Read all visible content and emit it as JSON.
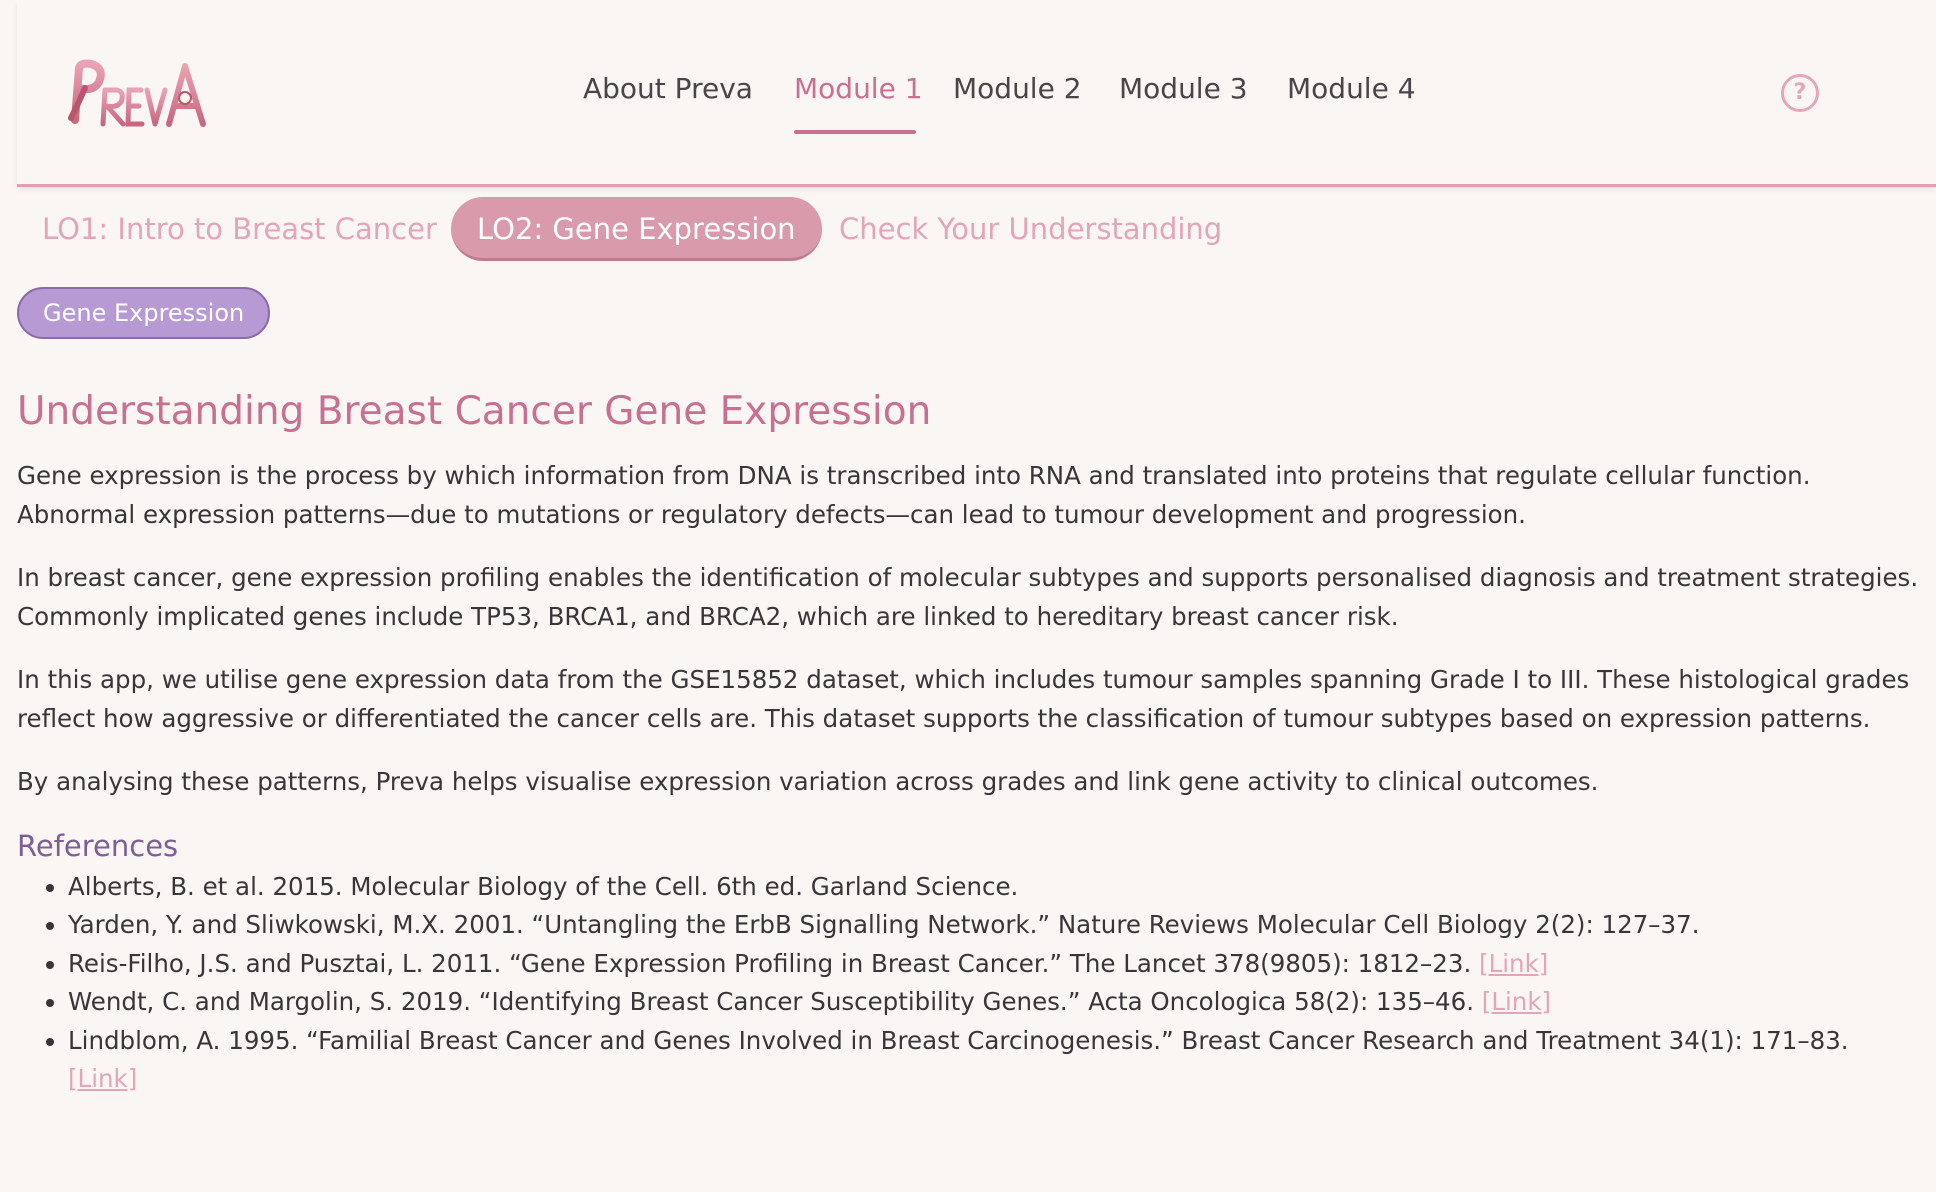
{
  "header": {
    "logo_text": "PrevA",
    "nav": [
      {
        "label": "About Preva",
        "active": false
      },
      {
        "label": "Module 1",
        "active": true
      },
      {
        "label": "Module 2",
        "active": false
      },
      {
        "label": "Module 3",
        "active": false
      },
      {
        "label": "Module 4",
        "active": false
      }
    ],
    "help_icon": "question-circle-icon",
    "help_glyph": "?"
  },
  "subtabs": [
    {
      "label": "LO1: Intro to Breast Cancer",
      "active": false
    },
    {
      "label": "LO2: Gene Expression",
      "active": true
    },
    {
      "label": "Check Your Understanding",
      "active": false
    }
  ],
  "pill": {
    "label": "Gene Expression"
  },
  "main": {
    "title": "Understanding Breast Cancer Gene Expression",
    "paragraphs": [
      "Gene expression is the process by which information from DNA is transcribed into RNA and translated into proteins that regulate cellular function. Abnormal expression patterns—due to mutations or regulatory defects—can lead to tumour development and progression.",
      "In breast cancer, gene expression profiling enables the identification of molecular subtypes and supports personalised diagnosis and treatment strategies. Commonly implicated genes include TP53, BRCA1, and BRCA2, which are linked to hereditary breast cancer risk.",
      "In this app, we utilise gene expression data from the GSE15852 dataset, which includes tumour samples spanning Grade I to III. These histological grades reflect how aggressive or differentiated the cancer cells are. This dataset supports the classification of tumour subtypes based on expression patterns.",
      "By analysing these patterns, Preva helps visualise expression variation across grades and link gene activity to clinical outcomes."
    ],
    "references_title": "References",
    "references": [
      {
        "text": "Alberts, B. et al. 2015. Molecular Biology of the Cell. 6th ed. Garland Science.",
        "link": ""
      },
      {
        "text": "Yarden, Y. and Sliwkowski, M.X. 2001. “Untangling the ErbB Signalling Network.” Nature Reviews Molecular Cell Biology 2(2): 127–37.",
        "link": ""
      },
      {
        "text": "Reis-Filho, J.S. and Pusztai, L. 2011. “Gene Expression Profiling in Breast Cancer.” The Lancet 378(9805): 1812–23.",
        "link": "[Link]"
      },
      {
        "text": "Wendt, C. and Margolin, S. 2019. “Identifying Breast Cancer Susceptibility Genes.” Acta Oncologica 58(2): 135–46.",
        "link": "[Link]"
      },
      {
        "text": "Lindblom, A. 1995. “Familial Breast Cancer and Genes Involved in Breast Carcinogenesis.” Breast Cancer Research and Treatment 34(1): 171–83.",
        "link": "[Link]"
      }
    ]
  },
  "colors": {
    "background": "#faf6f3",
    "accent_pink": "#c86f92",
    "light_pink": "#e3a6b8",
    "active_tab": "#d99aab",
    "pill_purple": "#b79ad3",
    "references_purple": "#7d5e96"
  }
}
